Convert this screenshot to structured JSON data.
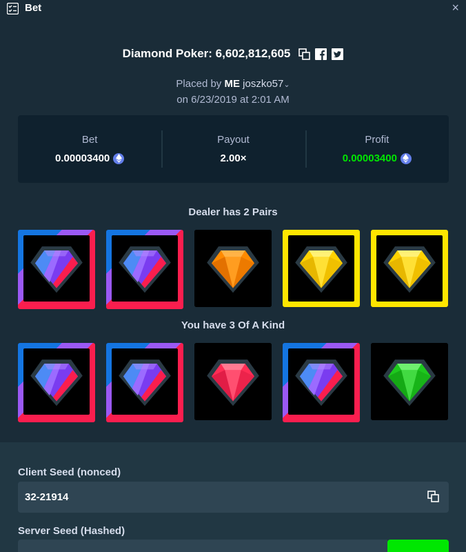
{
  "window": {
    "title": "Bet",
    "close_glyph": "×",
    "icon": "list-check-icon"
  },
  "headline": {
    "text": "Diamond Poker: 6,602,812,605",
    "icons": [
      "copy-icon",
      "facebook-icon",
      "twitter-icon"
    ]
  },
  "placed": {
    "prefix": "Placed by",
    "badge": "ME",
    "username": "joszko57",
    "date_line": "on 6/23/2019 at 2:01 AM"
  },
  "stats": {
    "bet_label": "Bet",
    "bet_value": "0.00003400",
    "payout_label": "Payout",
    "payout_value": "2.00×",
    "profit_label": "Profit",
    "profit_value": "0.00003400",
    "currency_icon": "ethereum-icon",
    "profit_color": "#00e701"
  },
  "dealer": {
    "label": "Dealer has 2 Pairs",
    "cards": [
      {
        "gem": "purple",
        "highlight": "multi"
      },
      {
        "gem": "purple",
        "highlight": "multi"
      },
      {
        "gem": "orange",
        "highlight": "none"
      },
      {
        "gem": "yellow",
        "highlight": "yellow"
      },
      {
        "gem": "yellow",
        "highlight": "yellow"
      }
    ]
  },
  "player": {
    "label": "You have 3 Of A Kind",
    "cards": [
      {
        "gem": "purple",
        "highlight": "multi"
      },
      {
        "gem": "purple",
        "highlight": "multi"
      },
      {
        "gem": "red",
        "highlight": "none"
      },
      {
        "gem": "purple",
        "highlight": "multi"
      },
      {
        "gem": "green",
        "highlight": "none"
      }
    ]
  },
  "client_seed": {
    "label": "Client Seed (nonced)",
    "value": "32-21914"
  },
  "server_seed": {
    "label": "Server Seed (Hashed)"
  },
  "colors": {
    "bg": "#1a2c38",
    "panel": "#0f212e",
    "lower": "#213743",
    "input": "#2f4553",
    "green": "#00e701",
    "yellow": "#ffe600"
  }
}
